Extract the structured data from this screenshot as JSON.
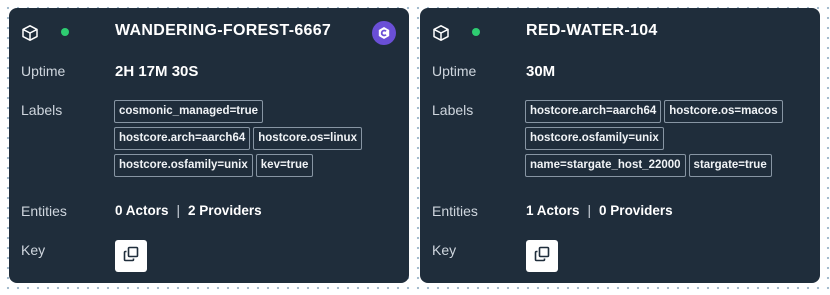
{
  "hosts": [
    {
      "name": "WANDERING-FOREST-6667",
      "status_color": "#2ecc71",
      "has_badge": true,
      "badge_icon": "cosmonic-logo",
      "uptime_label": "Uptime",
      "uptime": "2H 17M 30S",
      "labels_label": "Labels",
      "labels": [
        "cosmonic_managed=true",
        "hostcore.arch=aarch64",
        "hostcore.os=linux",
        "hostcore.osfamily=unix",
        "kev=true"
      ],
      "entities_label": "Entities",
      "actors": "0 Actors",
      "separator": "|",
      "providers": "2 Providers",
      "key_label": "Key"
    },
    {
      "name": "RED-WATER-104",
      "status_color": "#2ecc71",
      "has_badge": false,
      "uptime_label": "Uptime",
      "uptime": "30M",
      "labels_label": "Labels",
      "labels": [
        "hostcore.arch=aarch64",
        "hostcore.os=macos",
        "hostcore.osfamily=unix",
        "name=stargate_host_22000",
        "stargate=true"
      ],
      "entities_label": "Entities",
      "actors": "1 Actors",
      "separator": "|",
      "providers": "0 Providers",
      "key_label": "Key"
    }
  ],
  "colors": {
    "card_bg": "#1f2d3b",
    "badge_bg": "#6a4fd6",
    "status_online": "#2ecc71"
  },
  "icons": {
    "host": "cube-icon",
    "copy": "copy-icon"
  }
}
